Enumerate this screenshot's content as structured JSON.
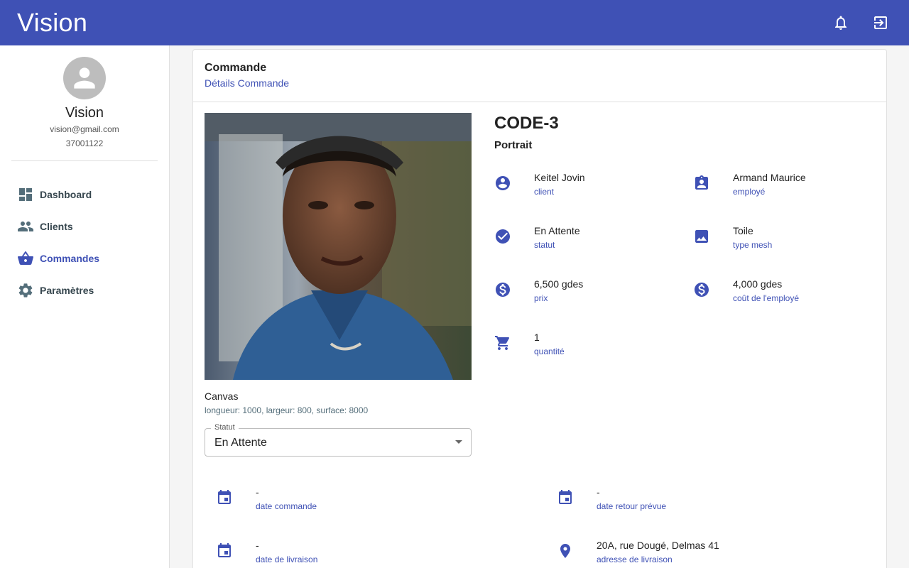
{
  "app": {
    "title": "Vision"
  },
  "topbar": {
    "notifications_icon": "bell-icon",
    "logout_icon": "logout-icon"
  },
  "profile": {
    "name": "Vision",
    "email": "vision@gmail.com",
    "phone": "37001122"
  },
  "sidebar": {
    "items": [
      {
        "label": "Dashboard",
        "icon": "dashboard-icon",
        "active": false
      },
      {
        "label": "Clients",
        "icon": "people-icon",
        "active": false
      },
      {
        "label": "Commandes",
        "icon": "basket-icon",
        "active": true
      },
      {
        "label": "Paramètres",
        "icon": "gear-icon",
        "active": false
      }
    ]
  },
  "card": {
    "title": "Commande",
    "subtitle": "Détails Commande"
  },
  "order": {
    "code": "CODE-3",
    "kind": "Portrait",
    "canvas_title": "Canvas",
    "canvas_dims": "longueur: 1000, largeur: 800, surface: 8000",
    "status_select": {
      "legend": "Statut",
      "value": "En Attente"
    },
    "details": {
      "client": {
        "value": "Keitel Jovin",
        "label": "client",
        "icon": "account-circle-icon"
      },
      "employe": {
        "value": "Armand Maurice",
        "label": "employé",
        "icon": "clipboard-account-icon"
      },
      "statut": {
        "value": "En Attente",
        "label": "statut",
        "icon": "check-circle-icon"
      },
      "type_mesh": {
        "value": "Toile",
        "label": "type mesh",
        "icon": "image-icon"
      },
      "prix": {
        "value": "6,500 gdes",
        "label": "prix",
        "icon": "dollar-circle-icon"
      },
      "cout_employe": {
        "value": "4,000 gdes",
        "label": "coût de l'employé",
        "icon": "dollar-circle-icon"
      },
      "quantite": {
        "value": "1",
        "label": "quantité",
        "icon": "cart-icon"
      }
    },
    "dates": {
      "date_commande": {
        "value": "-",
        "label": "date commande",
        "icon": "calendar-icon"
      },
      "date_retour": {
        "value": "-",
        "label": "date retour prévue",
        "icon": "calendar-icon"
      },
      "date_livraison": {
        "value": "-",
        "label": "date de livraison",
        "icon": "calendar-icon"
      },
      "adresse_livraison": {
        "value": "20A, rue Dougé, Delmas 41",
        "label": "adresse de livraison",
        "icon": "location-pin-icon"
      }
    }
  },
  "colors": {
    "primary": "#3f51b5",
    "nav_icon": "#546e7a",
    "background": "#f5f5f5"
  }
}
